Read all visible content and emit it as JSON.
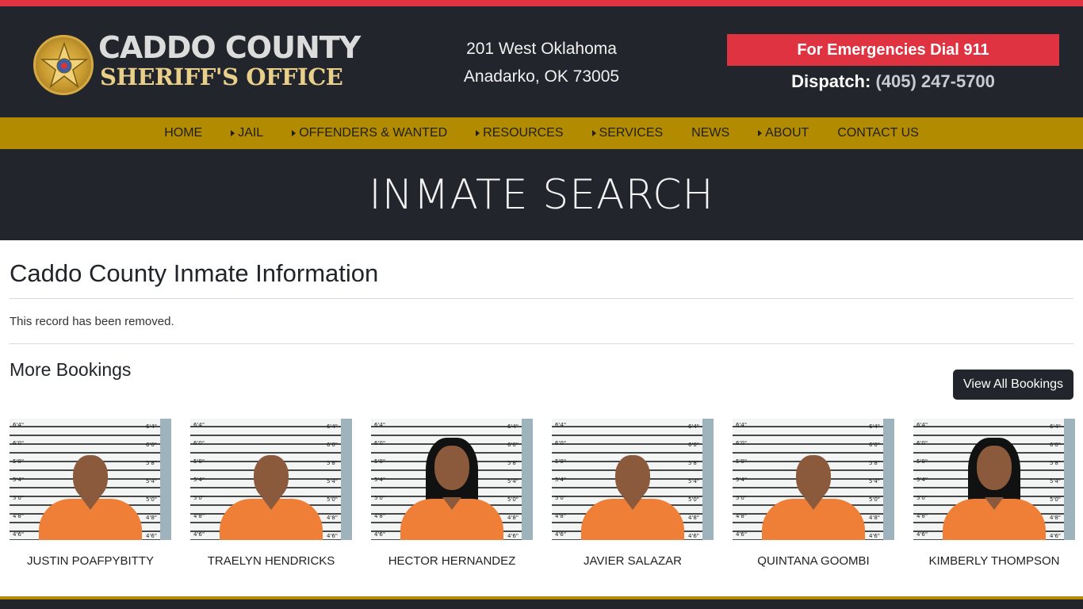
{
  "colors": {
    "accent_red": "#e03341",
    "nav_gold": "#b38b00",
    "dark_bg": "#22252b"
  },
  "logo": {
    "line1": "CADDO COUNTY",
    "line2": "SHERIFF'S OFFICE",
    "icon": "sheriff-star-badge"
  },
  "address": {
    "line1": "201 West Oklahoma",
    "line2": "Anadarko, OK 73005"
  },
  "emergency": {
    "label": "For Emergencies Dial 911"
  },
  "dispatch": {
    "label": "Dispatch:",
    "phone": "(405) 247-5700"
  },
  "nav": {
    "items": [
      {
        "label": "HOME",
        "has_submenu": false
      },
      {
        "label": "JAIL",
        "has_submenu": true
      },
      {
        "label": "OFFENDERS & WANTED",
        "has_submenu": true
      },
      {
        "label": "RESOURCES",
        "has_submenu": true
      },
      {
        "label": "SERVICES",
        "has_submenu": true
      },
      {
        "label": "NEWS",
        "has_submenu": false
      },
      {
        "label": "ABOUT",
        "has_submenu": true
      },
      {
        "label": "CONTACT US",
        "has_submenu": false
      }
    ]
  },
  "hero": {
    "title": "INMATE SEARCH"
  },
  "main": {
    "title": "Caddo County Inmate Information",
    "message": "This record has been removed.",
    "more_title": "More Bookings",
    "view_all_label": "View All Bookings"
  },
  "bookings": [
    {
      "name": "JUSTIN POAFPYBITTY",
      "hair": "short"
    },
    {
      "name": "TRAELYN HENDRICKS",
      "hair": "short"
    },
    {
      "name": "HECTOR HERNANDEZ",
      "hair": "long"
    },
    {
      "name": "JAVIER SALAZAR",
      "hair": "short"
    },
    {
      "name": "QUINTANA GOOMBI",
      "hair": "short"
    },
    {
      "name": "KIMBERLY THOMPSON",
      "hair": "long"
    }
  ]
}
